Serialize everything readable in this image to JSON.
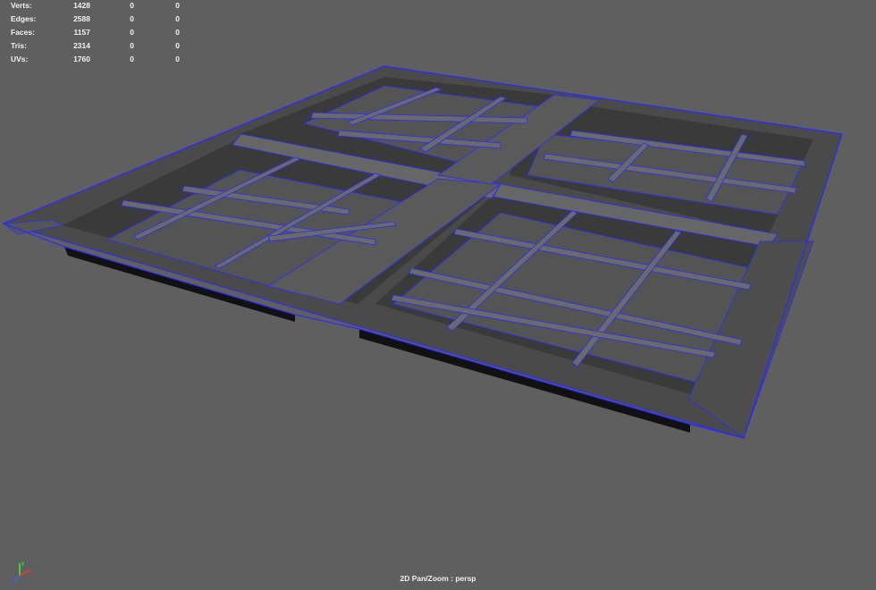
{
  "hud": {
    "rows": [
      {
        "label": "Verts:",
        "v1": "1428",
        "v2": "0",
        "v3": "0"
      },
      {
        "label": "Edges:",
        "v1": "2588",
        "v2": "0",
        "v3": "0"
      },
      {
        "label": "Faces:",
        "v1": "1157",
        "v2": "0",
        "v3": "0"
      },
      {
        "label": "Tris:",
        "v1": "2314",
        "v2": "0",
        "v3": "0"
      },
      {
        "label": "UVs:",
        "v1": "1760",
        "v2": "0",
        "v3": "0"
      }
    ]
  },
  "viewport": {
    "camera_label": "2D Pan/Zoom : persp",
    "background_color": "#5f5f5f",
    "wire_color": "#2a2aff"
  },
  "axis": {
    "x": "x",
    "y": "y",
    "z": "z"
  }
}
